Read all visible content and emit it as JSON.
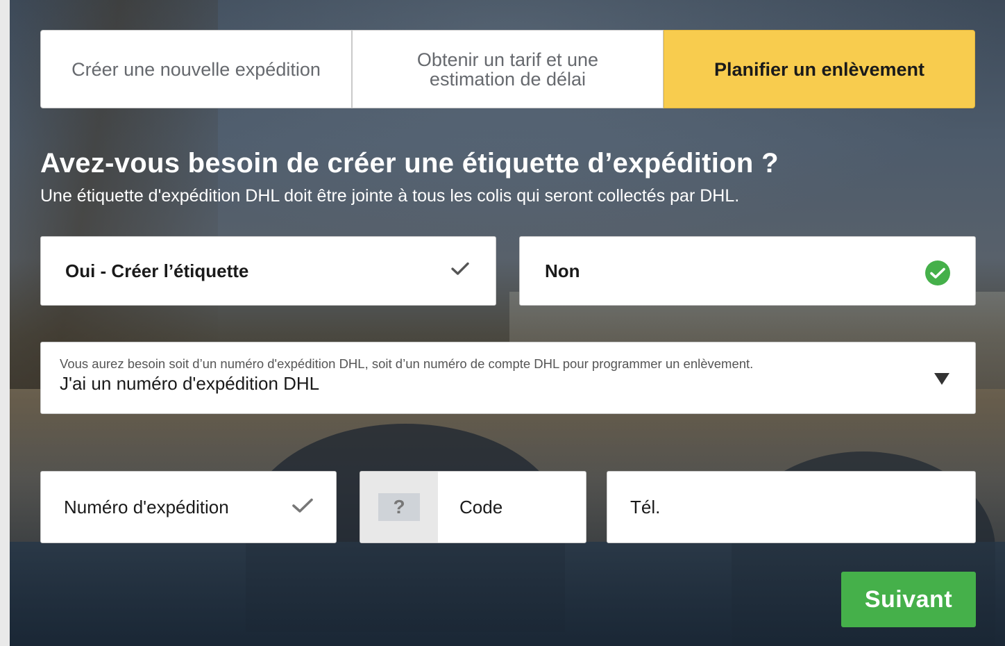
{
  "tabs": [
    {
      "label": "Créer une nouvelle expédition",
      "active": false
    },
    {
      "label": "Obtenir un tarif et une estimation de délai",
      "active": false
    },
    {
      "label": "Planifier un enlèvement",
      "active": true
    }
  ],
  "heading": "Avez-vous besoin de créer une étiquette d’expédition ?",
  "subheading": "Une étiquette d'expédition DHL doit être jointe à tous les colis qui seront collectés par DHL.",
  "options": {
    "yes": {
      "label": "Oui - Créer l’étiquette",
      "selected": false,
      "icon": "check-icon"
    },
    "no": {
      "label": "Non",
      "selected": true,
      "icon": "check-circle-icon"
    }
  },
  "select": {
    "hint": "Vous aurez besoin soit d’un numéro d'expédition DHL, soit d’un numéro de compte DHL pour programmer un enlèvement.",
    "value": "J'ai un numéro d'expédition DHL",
    "icon": "caret-down-icon"
  },
  "fields": {
    "shipment_number": {
      "placeholder": "Numéro d'expédition",
      "icon": "check-icon"
    },
    "code": {
      "placeholder": "Code",
      "help_glyph": "?",
      "icon": "question-icon"
    },
    "phone": {
      "placeholder": "Tél."
    }
  },
  "next_button": {
    "label": "Suivant"
  },
  "colors": {
    "accent_yellow": "#f8cc4e",
    "success_green": "#45b04a",
    "border": "#c9c9c9"
  }
}
